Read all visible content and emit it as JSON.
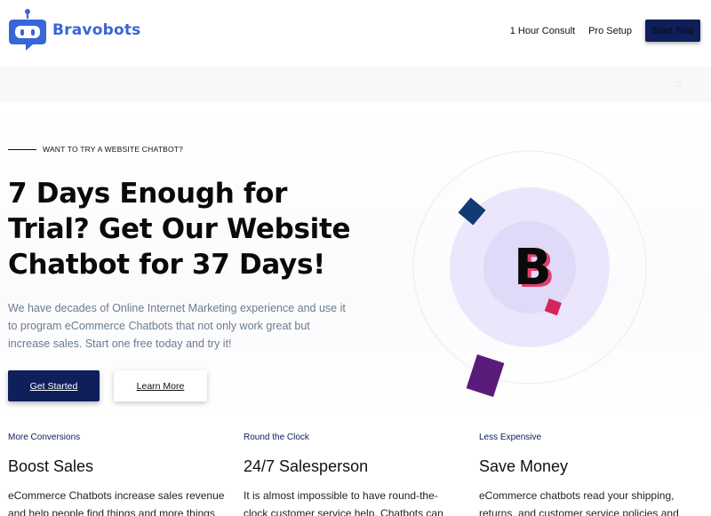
{
  "brand": {
    "name": "Bravobots",
    "accent": "#3866d6",
    "navy": "#0e1f5a"
  },
  "nav": {
    "items": [
      "1 Hour Consult",
      "Pro Setup"
    ],
    "cta": "Start Trial"
  },
  "hero": {
    "eyebrow": "WANT TO TRY A WEBSITE CHATBOT?",
    "headline_lines": [
      "7 Days Enough for",
      "Trial? Get Our Website",
      "Chatbot for 37 Days!"
    ],
    "lead_lines": [
      "We have decades of Online Internet Marketing experience and use it",
      "to program eCommerce Chatbots that not only work great but",
      "increase sales. Start one free today and try it!"
    ],
    "primary_button": "Get Started",
    "secondary_button": "Learn More",
    "badge_letter": "B"
  },
  "features": [
    {
      "kicker": "More Conversions",
      "title": "Boost Sales",
      "desc_lines": [
        "eCommerce Chatbots increase sales revenue",
        "and help people find things and more things"
      ]
    },
    {
      "kicker": "Round the Clock",
      "title": "24/7 Salesperson",
      "desc_lines": [
        "It is almost impossible to have round-the-",
        "clock customer service help. Chatbots can"
      ]
    },
    {
      "kicker": "Less Expensive",
      "title": "Save Money",
      "desc_lines": [
        "eCommerce chatbots read your shipping,",
        "returns, and customer service policies and"
      ]
    }
  ]
}
